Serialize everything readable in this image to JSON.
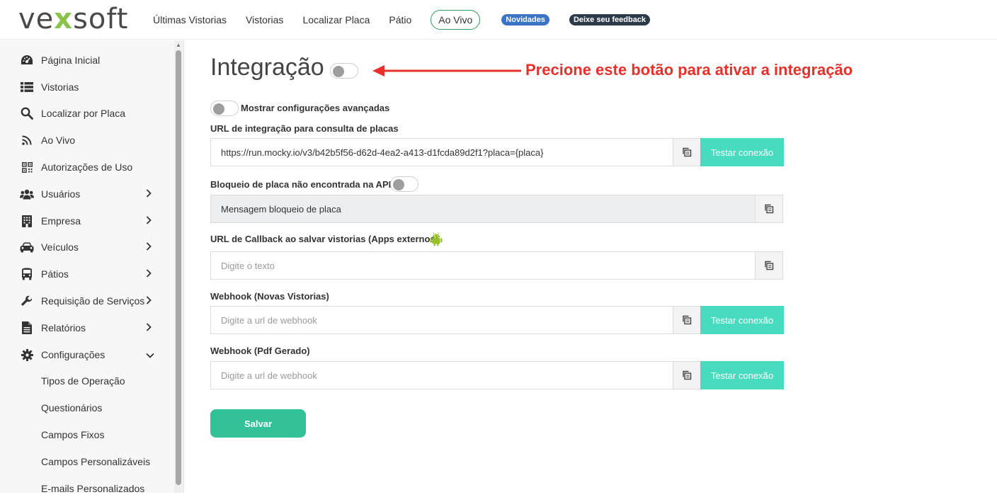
{
  "brand": {
    "logo_pre": "ve",
    "logo_x": "x",
    "logo_post": "soft"
  },
  "topnav": {
    "links": [
      "Últimas Vistorias",
      "Vistorias",
      "Localizar Placa",
      "Pátio"
    ],
    "live_pill": "Ao Vivo",
    "badge_news": "Novidades",
    "badge_feedback": "Deixe seu feedback"
  },
  "sidebar": {
    "items": [
      {
        "label": "Página Inicial",
        "icon": "dashboard-icon"
      },
      {
        "label": "Vistorias",
        "icon": "list-icon"
      },
      {
        "label": "Localizar por Placa",
        "icon": "search-icon"
      },
      {
        "label": "Ao Vivo",
        "icon": "rss-icon"
      },
      {
        "label": "Autorizações de Uso",
        "icon": "qrcode-icon"
      },
      {
        "label": "Usuários",
        "icon": "users-icon",
        "chevron": "›"
      },
      {
        "label": "Empresa",
        "icon": "building-icon",
        "chevron": "›"
      },
      {
        "label": "Veículos",
        "icon": "car-icon",
        "chevron": "›"
      },
      {
        "label": "Pátios",
        "icon": "bus-icon",
        "chevron": "›"
      },
      {
        "label": "Requisição de Serviços",
        "icon": "wrench-icon",
        "chevron": "›"
      },
      {
        "label": "Relatórios",
        "icon": "file-icon",
        "chevron": "›"
      },
      {
        "label": "Configurações",
        "icon": "gear-icon",
        "chevron": "⌄"
      }
    ],
    "subitems": [
      "Tipos de Operação",
      "Questionários",
      "Campos Fixos",
      "Campos Personalizáveis",
      "E-mails Personalizados"
    ]
  },
  "page": {
    "title": "Integração",
    "annotation": "Precione este botão para ativar a integração",
    "advanced_label": "Mostrar configurações avançadas",
    "plate_url_label": "URL de integração para consulta de placas",
    "plate_url_value": "https://run.mocky.io/v3/b42b5f56-d62d-4ea2-a413-d1fcda89d2f1?placa={placa}",
    "block_label": "Bloqueio de placa não encontrada na API",
    "block_placeholder": "Mensagem bloqueio de placa",
    "callback_label": "URL de Callback ao salvar vistorias (Apps externos)",
    "callback_placeholder": "Digite o texto",
    "webhook_new_label": "Webhook (Novas Vistorias)",
    "webhook_new_placeholder": "Digite a url de webhook",
    "webhook_pdf_label": "Webhook (Pdf Gerado)",
    "webhook_pdf_placeholder": "Digite a url de webhook",
    "test_label": "Testar conexão",
    "save_label": "Salvar"
  },
  "colors": {
    "accent": "#47dbbf",
    "save": "#33c197",
    "annotation": "#e8302a",
    "logo_x": "#8bc34a"
  }
}
